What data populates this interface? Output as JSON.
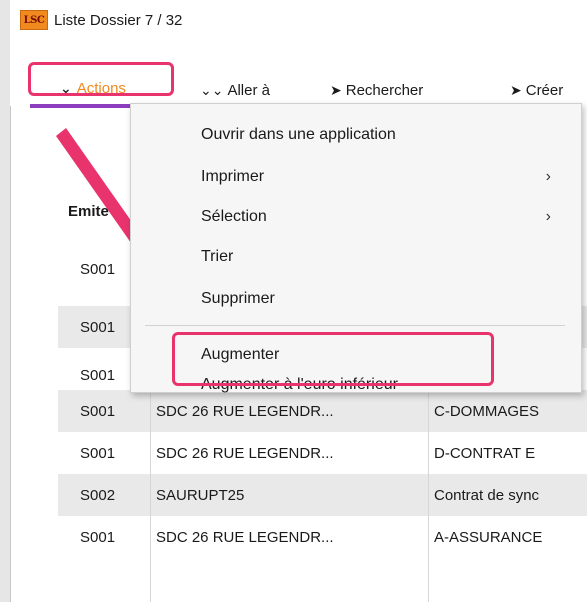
{
  "window": {
    "logo_text": "LSC",
    "title": "Liste  Dossier 7 / 32"
  },
  "toolbar": {
    "actions_label": "Actions",
    "goto_label": "Aller à",
    "search_label": "Rechercher",
    "create_label": "Créer"
  },
  "table": {
    "header_col1": "Emite",
    "rows": [
      {
        "c1": "S001",
        "c2": "",
        "c3": "",
        "alt": false
      },
      {
        "c1": "S001",
        "c2": "",
        "c3": "",
        "alt": true
      },
      {
        "c1": "S001",
        "c2": "",
        "c3": "",
        "alt": false
      },
      {
        "c1": "S001",
        "c2": "SDC 26 RUE LEGENDR...",
        "c3": "C-DOMMAGES",
        "alt": true
      },
      {
        "c1": "S001",
        "c2": "SDC 26 RUE LEGENDR...",
        "c3": "D-CONTRAT E",
        "alt": false
      },
      {
        "c1": "S002",
        "c2": "SAURUPT25",
        "c3": "Contrat de sync",
        "alt": true
      },
      {
        "c1": "S001",
        "c2": "SDC 26 RUE LEGENDR...",
        "c3": "A-ASSURANCE",
        "alt": false
      }
    ]
  },
  "menu": {
    "items": [
      {
        "label": "Ouvrir dans une application",
        "submenu": false
      },
      {
        "label": "Imprimer",
        "submenu": true
      },
      {
        "label": "Sélection",
        "submenu": true
      },
      {
        "label": "Trier",
        "submenu": false
      },
      {
        "label": "Supprimer",
        "submenu": false
      },
      {
        "label": "Augmenter",
        "submenu": false
      },
      {
        "label": "Augmenter à l'euro inférieur",
        "submenu": false
      }
    ]
  },
  "colors": {
    "highlight": "#e8336d",
    "accent_orange": "#f08a1e",
    "accent_purple": "#8b3fbf"
  }
}
